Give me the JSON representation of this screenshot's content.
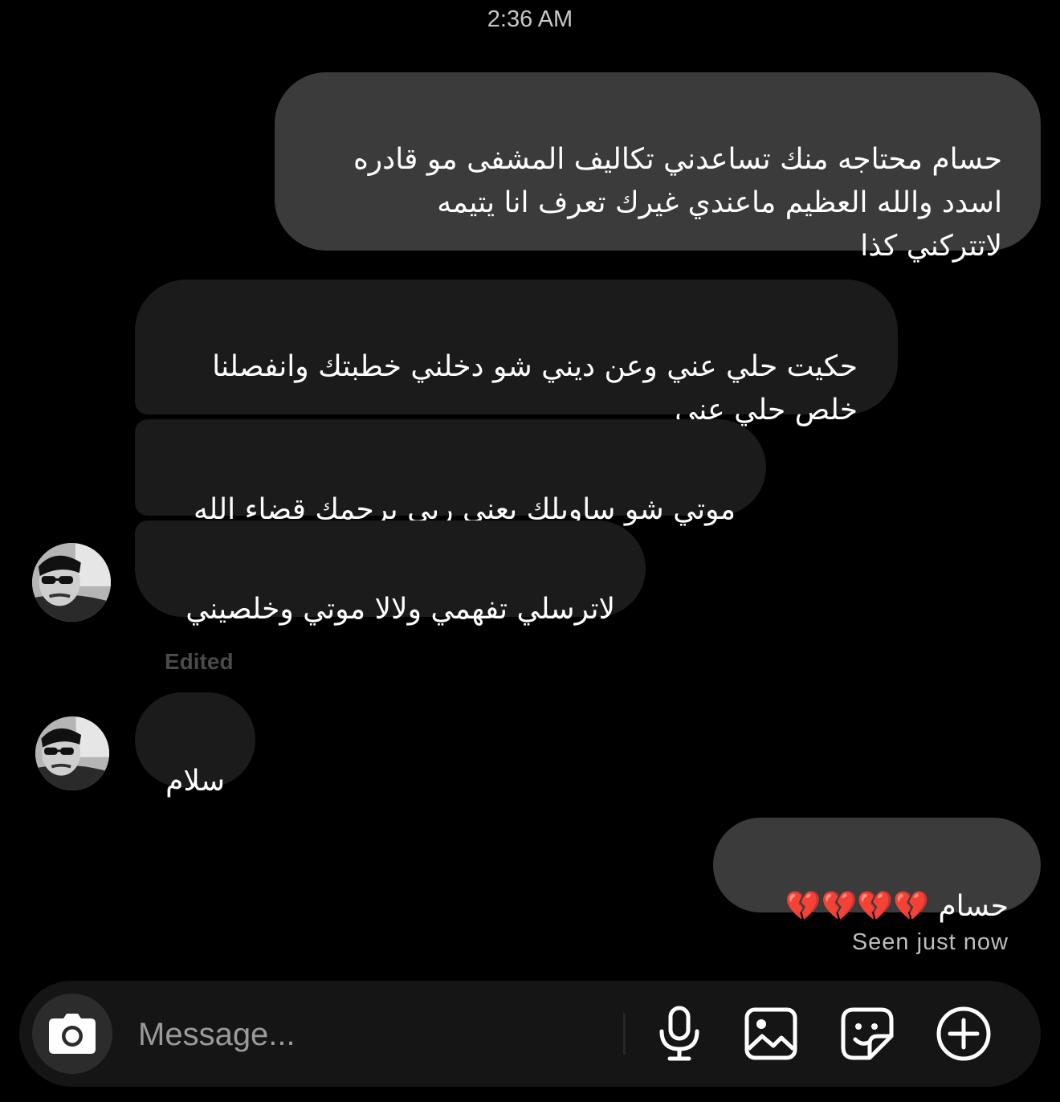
{
  "timestamp": "2:36 AM",
  "messages": {
    "m1": "حسام محتاجه منك تساعدني تكاليف المشفى مو قادره\nاسدد والله العظيم ماعندي غيرك تعرف انا يتيمه\nلاتتركني كذا",
    "m2": "حكيت حلي عني وعن ديني شو دخلني خطبتك وانفصلنا\nخلص حلي عني",
    "m3": "موتي شو ساويلك يعني ربي يرحمك قضاء الله",
    "m4": "لاترسلي تفهمي ولالا موتي وخلصيني",
    "edited_label": "Edited",
    "m5": "سلام",
    "m6": "حسام 💔💔💔💔"
  },
  "seen_status": "Seen just now",
  "composer": {
    "placeholder": "Message...",
    "icons": [
      "camera-icon",
      "microphone-icon",
      "gallery-icon",
      "sticker-icon",
      "plus-icon"
    ]
  },
  "colors": {
    "background": "#000000",
    "sent_bubble": "#3b3b3b",
    "received_bubble": "#1b1b1b",
    "composer": "#151515"
  }
}
